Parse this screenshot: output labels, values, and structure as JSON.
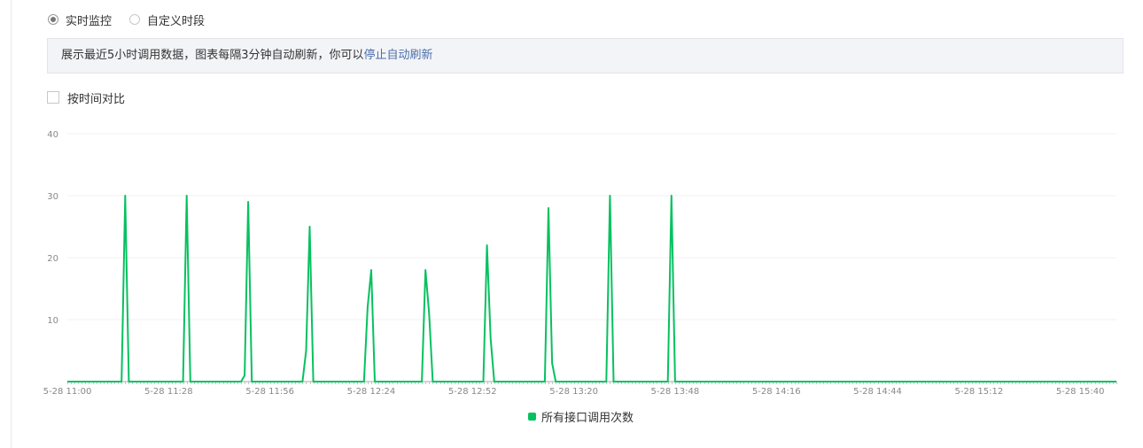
{
  "mode": {
    "options": [
      {
        "label": "实时监控",
        "checked": true
      },
      {
        "label": "自定义时段",
        "checked": false
      }
    ]
  },
  "info": {
    "text": "展示最近5小时调用数据，图表每隔3分钟自动刷新，你可以",
    "link": "停止自动刷新"
  },
  "compare": {
    "label": "按时间对比",
    "checked": false
  },
  "colors": {
    "series": "#07c160",
    "link": "#4e6ea8"
  },
  "chart_data": {
    "type": "line",
    "title": "",
    "xlabel": "",
    "ylabel": "",
    "ylim": [
      0,
      40
    ],
    "yticks": [
      10,
      20,
      30,
      40
    ],
    "y_tick_labels": [
      "10",
      "20",
      "30",
      "40"
    ],
    "xlim_minutes": [
      "11:00",
      "15:50"
    ],
    "x_tick_labels": [
      "5-28 11:00",
      "5-28 11:28",
      "5-28 11:56",
      "5-28 12:24",
      "5-28 12:52",
      "5-28 13:20",
      "5-28 13:48",
      "5-28 14:16",
      "5-28 14:44",
      "5-28 15:12",
      "5-28 15:40"
    ],
    "grid": true,
    "legend_position": "bottom",
    "series": [
      {
        "name": "所有接口调用次数",
        "color": "#07c160",
        "points": [
          {
            "x": "11:00",
            "y": 0
          },
          {
            "x": "11:15",
            "y": 0
          },
          {
            "x": "11:16",
            "y": 30
          },
          {
            "x": "11:17",
            "y": 0
          },
          {
            "x": "11:32",
            "y": 0
          },
          {
            "x": "11:33",
            "y": 30
          },
          {
            "x": "11:34",
            "y": 0
          },
          {
            "x": "11:48",
            "y": 0
          },
          {
            "x": "11:49",
            "y": 1
          },
          {
            "x": "11:50",
            "y": 29
          },
          {
            "x": "11:51",
            "y": 0
          },
          {
            "x": "12:05",
            "y": 0
          },
          {
            "x": "12:06",
            "y": 5
          },
          {
            "x": "12:07",
            "y": 25
          },
          {
            "x": "12:08",
            "y": 0
          },
          {
            "x": "12:22",
            "y": 0
          },
          {
            "x": "12:23",
            "y": 12
          },
          {
            "x": "12:24",
            "y": 18
          },
          {
            "x": "12:25",
            "y": 0
          },
          {
            "x": "12:38",
            "y": 0
          },
          {
            "x": "12:39",
            "y": 18
          },
          {
            "x": "12:40",
            "y": 11
          },
          {
            "x": "12:41",
            "y": 0
          },
          {
            "x": "12:55",
            "y": 0
          },
          {
            "x": "12:56",
            "y": 22
          },
          {
            "x": "12:57",
            "y": 7
          },
          {
            "x": "12:58",
            "y": 0
          },
          {
            "x": "13:12",
            "y": 0
          },
          {
            "x": "13:13",
            "y": 28
          },
          {
            "x": "13:14",
            "y": 3
          },
          {
            "x": "13:15",
            "y": 0
          },
          {
            "x": "13:29",
            "y": 0
          },
          {
            "x": "13:30",
            "y": 30
          },
          {
            "x": "13:31",
            "y": 0
          },
          {
            "x": "13:46",
            "y": 0
          },
          {
            "x": "13:47",
            "y": 30
          },
          {
            "x": "13:48",
            "y": 0
          },
          {
            "x": "15:50",
            "y": 0
          }
        ]
      }
    ]
  }
}
